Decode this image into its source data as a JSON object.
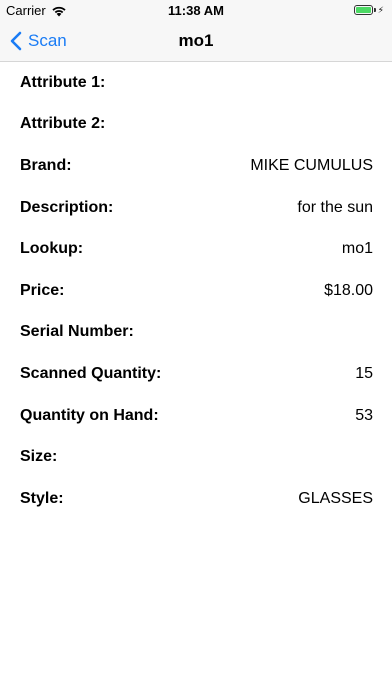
{
  "status_bar": {
    "carrier": "Carrier",
    "time": "11:38 AM",
    "battery_color": "#4cd964",
    "wifi_icon": "wifi-icon",
    "battery_icon": "battery-icon"
  },
  "nav": {
    "back_label": "Scan",
    "title": "mo1",
    "accent_color": "#1a7cf5"
  },
  "details": [
    {
      "label": "Attribute 1:",
      "value": ""
    },
    {
      "label": "Attribute 2:",
      "value": ""
    },
    {
      "label": "Brand:",
      "value": "MIKE CUMULUS"
    },
    {
      "label": "Description:",
      "value": "for the sun"
    },
    {
      "label": "Lookup:",
      "value": "mo1"
    },
    {
      "label": "Price:",
      "value": "$18.00"
    },
    {
      "label": "Serial Number:",
      "value": ""
    },
    {
      "label": "Scanned Quantity:",
      "value": "15"
    },
    {
      "label": "Quantity on Hand:",
      "value": "53"
    },
    {
      "label": "Size:",
      "value": ""
    },
    {
      "label": "Style:",
      "value": "GLASSES"
    }
  ]
}
